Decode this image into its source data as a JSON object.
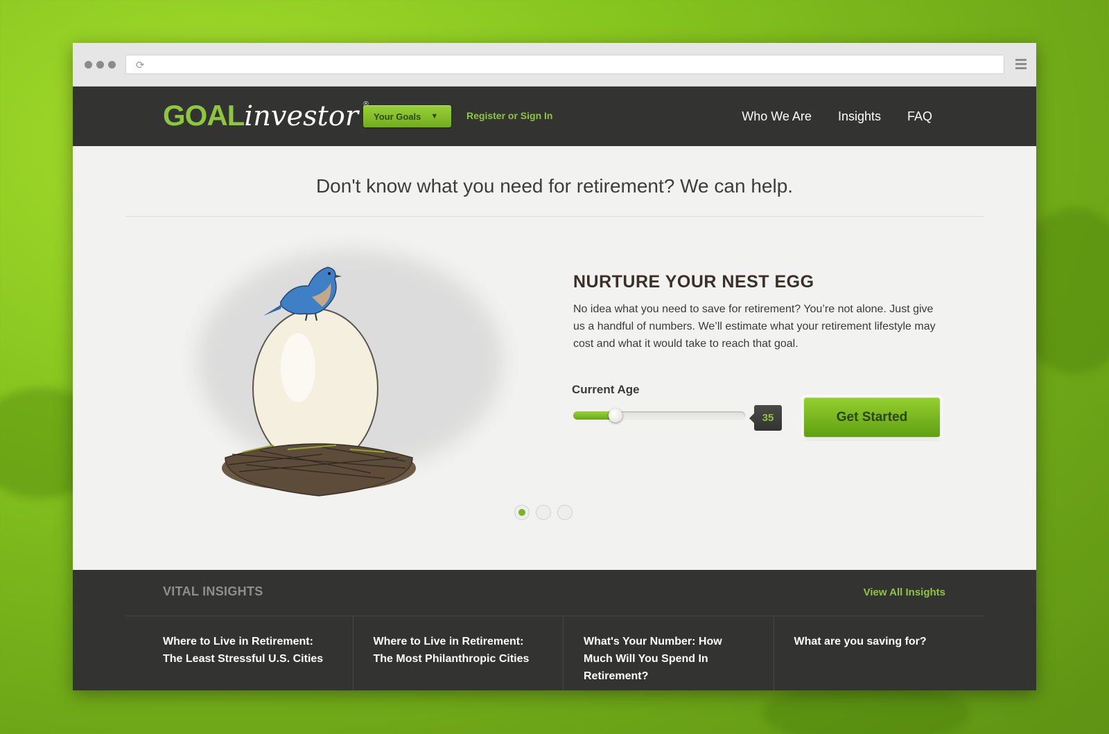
{
  "browser": {
    "url": ""
  },
  "nav": {
    "logo_goal": "GOAL",
    "logo_investor": "investor",
    "logo_mark": "®",
    "your_goals_label": "Your Goals",
    "register_label": "Register or Sign In",
    "links": [
      "Who We Are",
      "Insights",
      "FAQ"
    ]
  },
  "hero": {
    "headline": "Don't know what you need for retirement? We can help.",
    "promo_title": "NURTURE YOUR NEST EGG",
    "promo_text": "No idea what you need to save for retirement? You’re not alone.  Just give us a handful of numbers. We’ll estimate what your retirement lifestyle may cost and what it would take to reach that goal.",
    "age_label": "Current Age",
    "age_value": "35",
    "age_slider_fraction": 0.22,
    "cta_label": "Get Started",
    "pager": {
      "count": 3,
      "active": 0
    }
  },
  "insights": {
    "title": "VITAL INSIGHTS",
    "view_all": "View All Insights",
    "articles": [
      "Where to Live in Retirement: The Least Stressful U.S. Cities",
      "Where to Live in Retirement: The Most Philanthropic Cities",
      "What's Your Number: How Much Will You Spend In Retirement?",
      "What are you saving for?"
    ]
  },
  "colors": {
    "brand_green": "#8dc63f",
    "dark": "#333332",
    "background": "#86c51f"
  }
}
